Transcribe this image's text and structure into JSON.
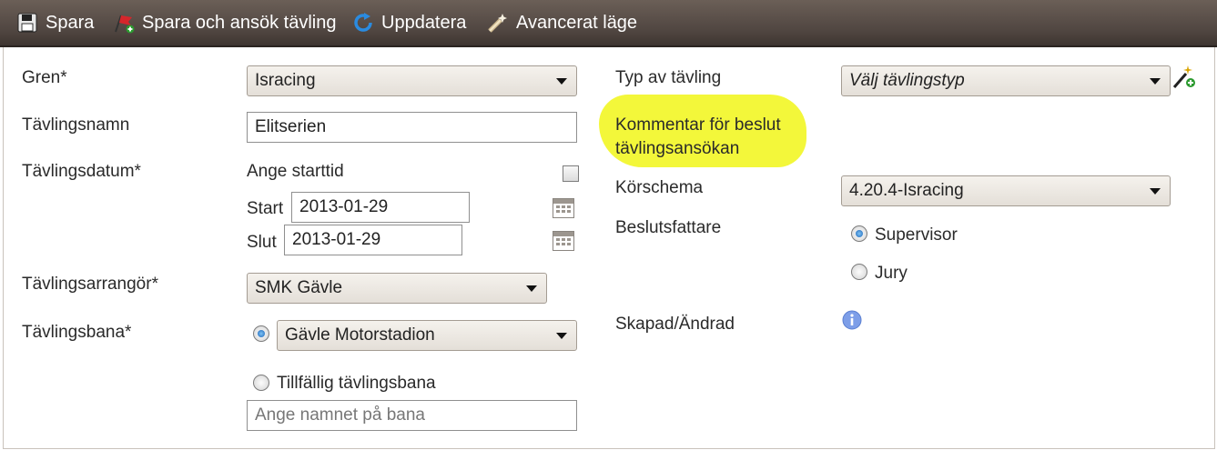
{
  "toolbar": {
    "save_label": "Spara",
    "save_apply_label": "Spara och ansök tävling",
    "refresh_label": "Uppdatera",
    "advanced_label": "Avancerat läge"
  },
  "form": {
    "gren_label": "Gren*",
    "gren_value": "Isracing",
    "name_label": "Tävlingsnamn",
    "name_value": "Elitserien",
    "date_label": "Tävlingsdatum*",
    "starttime_label": "Ange starttid",
    "start_label": "Start",
    "start_value": "2013-01-29",
    "end_label": "Slut",
    "end_value": "2013-01-29",
    "organizer_label": "Tävlingsarrangör*",
    "organizer_value": "SMK Gävle",
    "track_label": "Tävlingsbana*",
    "track_value": "Gävle Motorstadion",
    "temp_track_label": "Tillfällig tävlingsbana",
    "temp_track_placeholder": "Ange namnet på bana",
    "type_label": "Typ av tävling",
    "type_value": "Välj tävlingstyp",
    "comment_label_line1": "Kommentar för beslut",
    "comment_label_line2": "tävlingsansökan",
    "schedule_label": "Körschema",
    "schedule_value": "4.20.4-Isracing",
    "decision_label": "Beslutsfattare",
    "supervisor_label": "Supervisor",
    "jury_label": "Jury",
    "created_label": "Skapad/Ändrad"
  },
  "colors": {
    "toolbar_bg": "#4f4540",
    "highlight": "#f3f73a",
    "radio_selected": "#1a63b8"
  },
  "icons": [
    "save-icon",
    "flag-add-icon",
    "refresh-icon",
    "wand-icon",
    "calendar-icon",
    "info-icon",
    "magic-add-icon"
  ]
}
